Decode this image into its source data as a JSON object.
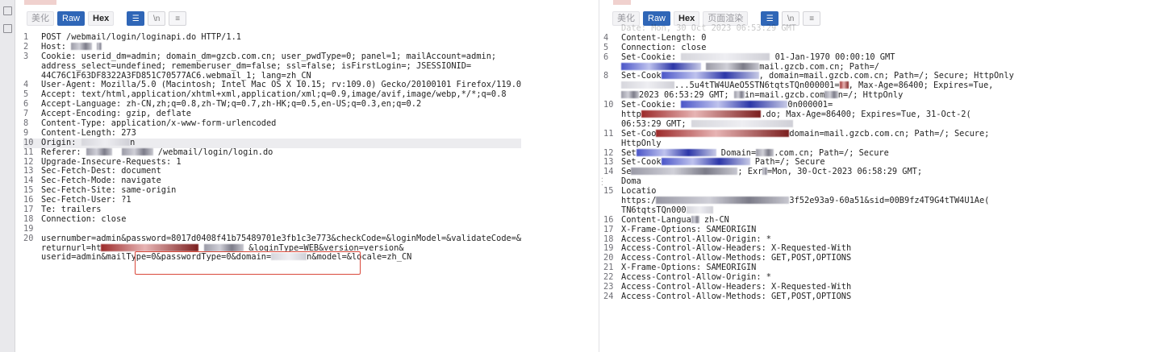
{
  "left_toolbar": {
    "tabs": [
      {
        "label": "美化",
        "active": false
      },
      {
        "label": "Raw",
        "active": true
      },
      {
        "label": "Hex",
        "active": false
      }
    ],
    "buttons": [
      {
        "icon": "wrap-icon",
        "glyph": "☰"
      },
      {
        "icon": "newline-icon",
        "glyph": "\\n"
      },
      {
        "icon": "menu-icon",
        "glyph": "≡"
      }
    ]
  },
  "right_toolbar": {
    "tabs": [
      {
        "label": "美化",
        "active": false
      },
      {
        "label": "Raw",
        "active": true
      },
      {
        "label": "Hex",
        "active": false
      },
      {
        "label": "页面渲染",
        "active": false
      }
    ],
    "buttons": [
      {
        "icon": "wrap-icon",
        "glyph": "☰"
      },
      {
        "icon": "newline-icon",
        "glyph": "\\n"
      },
      {
        "icon": "menu-icon",
        "glyph": "≡"
      }
    ]
  },
  "request_lines": [
    {
      "n": "1",
      "parts": [
        {
          "t": "POST /webmail/login/loginapi.do HTTP/1.1"
        }
      ]
    },
    {
      "n": "2",
      "parts": [
        {
          "t": "Host: "
        },
        {
          "r": 46
        },
        {
          "t": " "
        },
        {
          "r": 12
        }
      ]
    },
    {
      "n": "3",
      "parts": [
        {
          "t": "Cookie: userid_dm=admin; domain_dm=gzcb.com.cn; user_pwdType=0; panel=1; mailAccount=admin;"
        }
      ]
    },
    {
      "n": "",
      "parts": [
        {
          "t": "address_select=undefined; rememberuser_dm=false; ssl=false; isFirstLogin=; JSESSIONID="
        }
      ]
    },
    {
      "n": "",
      "parts": [
        {
          "t": "44C76C1F63DF8322A3FD851C70577AC6.webmail_1; lang=zh_CN"
        }
      ]
    },
    {
      "n": "4",
      "parts": [
        {
          "t": "User-Agent: Mozilla/5.0 (Macintosh; Intel Mac OS X 10.15; rv:109.0) Gecko/20100101 Firefox/119.0"
        }
      ]
    },
    {
      "n": "5",
      "parts": [
        {
          "t": "Accept: text/html,application/xhtml+xml,application/xml;q=0.9,image/avif,image/webp,*/*;q=0.8"
        }
      ]
    },
    {
      "n": "6",
      "parts": [
        {
          "t": "Accept-Language: zh-CN,zh;q=0.8,zh-TW;q=0.7,zh-HK;q=0.5,en-US;q=0.3,en;q=0.2"
        }
      ]
    },
    {
      "n": "7",
      "parts": [
        {
          "t": "Accept-Encoding: gzip, deflate"
        }
      ]
    },
    {
      "n": "8",
      "parts": [
        {
          "t": "Content-Type: application/x-www-form-urlencoded"
        }
      ]
    },
    {
      "n": "9",
      "parts": [
        {
          "t": "Content-Length: 273"
        }
      ]
    },
    {
      "n": "10",
      "hl": true,
      "parts": [
        {
          "t": "Origin: "
        },
        {
          "r": 110,
          "c": "light"
        },
        {
          "t": "n"
        }
      ]
    },
    {
      "n": "11",
      "parts": [
        {
          "t": "Referer: "
        },
        {
          "r": 58
        },
        {
          "t": "  "
        },
        {
          "r": 70
        },
        {
          "t": " /webmail/login/login.do"
        }
      ]
    },
    {
      "n": "12",
      "parts": [
        {
          "t": "Upgrade-Insecure-Requests: 1"
        }
      ]
    },
    {
      "n": "13",
      "parts": [
        {
          "t": "Sec-Fetch-Dest: document"
        }
      ]
    },
    {
      "n": "14",
      "parts": [
        {
          "t": "Sec-Fetch-Mode: navigate"
        }
      ]
    },
    {
      "n": "15",
      "parts": [
        {
          "t": "Sec-Fetch-Site: same-origin"
        }
      ]
    },
    {
      "n": "16",
      "parts": [
        {
          "t": "Sec-Fetch-User: ?1"
        }
      ]
    },
    {
      "n": "17",
      "parts": [
        {
          "t": "Te: trailers"
        }
      ]
    },
    {
      "n": "18",
      "parts": [
        {
          "t": "Connection: close"
        }
      ]
    },
    {
      "n": "19",
      "parts": [
        {
          "t": ""
        }
      ]
    },
    {
      "n": "20",
      "parts": [
        {
          "t": "usernumber=admin&password=8017d0408f41b75489701e3fb1c3e773&checkCode=&loginModel=&validateCode=&"
        }
      ]
    },
    {
      "n": "",
      "parts": [
        {
          "t": "returnurl=ht"
        },
        {
          "r": 220,
          "c": "red"
        },
        {
          "t": " "
        },
        {
          "r": 90
        },
        {
          "t": " &loginType=WEB&version=version&"
        }
      ]
    },
    {
      "n": "",
      "parts": [
        {
          "t": "userid=admin&mailType=0&passwordType=0&domain="
        },
        {
          "r": 80,
          "c": "light"
        },
        {
          "t": "n&model=&locale=zh_CN"
        }
      ]
    }
  ],
  "response_lines": [
    {
      "n": "",
      "parts": [
        {
          "t": "Date: Mon, 30 Oct 2023 06:53:29 GMT"
        }
      ],
      "faded": true
    },
    {
      "n": "4",
      "parts": [
        {
          "t": "Content-Length: 0"
        }
      ]
    },
    {
      "n": "5",
      "parts": [
        {
          "t": "Connection: close"
        }
      ]
    },
    {
      "n": "6",
      "parts": [
        {
          "t": "Set-Cookie: "
        },
        {
          "r": 200,
          "c": "light"
        },
        {
          "t": " 01-Jan-1970 00:00:10 GMT"
        }
      ]
    },
    {
      "n": "",
      "parts": [
        {
          "r": 180,
          "c": "blue"
        },
        {
          "t": " "
        },
        {
          "r": 120
        },
        {
          "t": "mail.gzcb.com.cn; Path=/"
        }
      ]
    },
    {
      "n": "8",
      "parts": [
        {
          "t": "Set-Cook"
        },
        {
          "r": 220,
          "c": "blue"
        },
        {
          "t": ", "
        },
        {
          "t": "domain=mail.gzcb.com.cn; Path=/; Secure; HttpOnly"
        }
      ]
    },
    {
      "n": "",
      "parts": [
        {
          "r": 120,
          "c": "light"
        },
        {
          "t": "...5u4tTW4UAeO5STN6tqtsTQn000001="
        },
        {
          "r": 20,
          "c": "red"
        },
        {
          "t": ", Max-Age=86400; Expires=Tue,"
        }
      ]
    },
    {
      "n": "",
      "parts": [
        {
          "r": 40
        },
        {
          "t": "2023 06:53:29 GMT; "
        },
        {
          "r": 24
        },
        {
          "t": "in=mail.gzcb.com"
        },
        {
          "r": 30
        },
        {
          "t": "n=/; HttpOnly"
        }
      ]
    },
    {
      "n": "10",
      "parts": [
        {
          "t": "Set-Cookie: "
        },
        {
          "r": 240,
          "c": "blue"
        },
        {
          "t": "0n000001="
        }
      ]
    },
    {
      "n": "",
      "parts": [
        {
          "t": "http"
        },
        {
          "r": 270,
          "c": "red"
        },
        {
          "t": ".do; Max-Age=86400; Expires=Tue, 31-Oct-2("
        }
      ]
    },
    {
      "n": "",
      "parts": [
        {
          "t": "06:53:29 GMT; "
        },
        {
          "r": 230,
          "c": "light"
        }
      ]
    },
    {
      "n": "11",
      "parts": [
        {
          "t": "Set-Coo"
        },
        {
          "r": 300,
          "c": "red"
        },
        {
          "t": "domain=mail.gzcb.com.cn; Path=/; Secure;"
        }
      ]
    },
    {
      "n": "",
      "parts": [
        {
          "t": "HttpOnly"
        }
      ]
    },
    {
      "n": "12",
      "parts": [
        {
          "t": "Set"
        },
        {
          "r": 180,
          "c": "blue"
        },
        {
          "t": " Domain="
        },
        {
          "r": 40
        },
        {
          "t": ".com.cn; Path=/; Secure"
        }
      ]
    },
    {
      "n": "13",
      "parts": [
        {
          "t": "Set-Cook"
        },
        {
          "r": 200,
          "c": "blue"
        },
        {
          "t": " Path=/; Secure"
        }
      ]
    },
    {
      "n": "14",
      "parts": [
        {
          "t": "Se"
        },
        {
          "r": 240
        },
        {
          "t": "; Exr"
        },
        {
          "r": 10
        },
        {
          "t": "=Mon, 30-Oct-2023 06:58:29 GMT;"
        }
      ]
    },
    {
      "n": "",
      "parts": [
        {
          "t": "Doma"
        }
      ]
    },
    {
      "n": "15",
      "parts": [
        {
          "t": "Locatio"
        }
      ]
    },
    {
      "n": "",
      "parts": [
        {
          "t": "https:/"
        },
        {
          "r": 300
        },
        {
          "t": "3f52e93a9-60a51&sid=00B9fz4T9G4tTW4U1Ae("
        }
      ]
    },
    {
      "n": "",
      "parts": [
        {
          "t": "TN6tqtsTQn000"
        },
        {
          "r": 60,
          "c": "light"
        }
      ]
    },
    {
      "n": "16",
      "parts": [
        {
          "t": "Content-Langua"
        },
        {
          "r": 18
        },
        {
          "t": " zh-CN"
        }
      ]
    },
    {
      "n": "17",
      "parts": [
        {
          "t": "X-Frame-Options: SAMEORIGIN"
        }
      ]
    },
    {
      "n": "18",
      "parts": [
        {
          "t": "Access-Control-Allow-Origin: *"
        }
      ]
    },
    {
      "n": "19",
      "parts": [
        {
          "t": "Access-Control-Allow-Headers: X-Requested-With"
        }
      ]
    },
    {
      "n": "20",
      "parts": [
        {
          "t": "Access-Control-Allow-Methods: GET,POST,OPTIONS"
        }
      ]
    },
    {
      "n": "21",
      "parts": [
        {
          "t": "X-Frame-Options: SAMEORIGIN"
        }
      ]
    },
    {
      "n": "22",
      "parts": [
        {
          "t": "Access-Control-Allow-Origin: *"
        }
      ]
    },
    {
      "n": "23",
      "parts": [
        {
          "t": "Access-Control-Allow-Headers: X-Requested-With"
        }
      ]
    },
    {
      "n": "24",
      "parts": [
        {
          "t": "Access-Control-Allow-Methods: GET,POST,OPTIONS"
        }
      ]
    }
  ],
  "colors": {
    "accent": "#2f66b7",
    "highlight_box": "#d9483b"
  }
}
